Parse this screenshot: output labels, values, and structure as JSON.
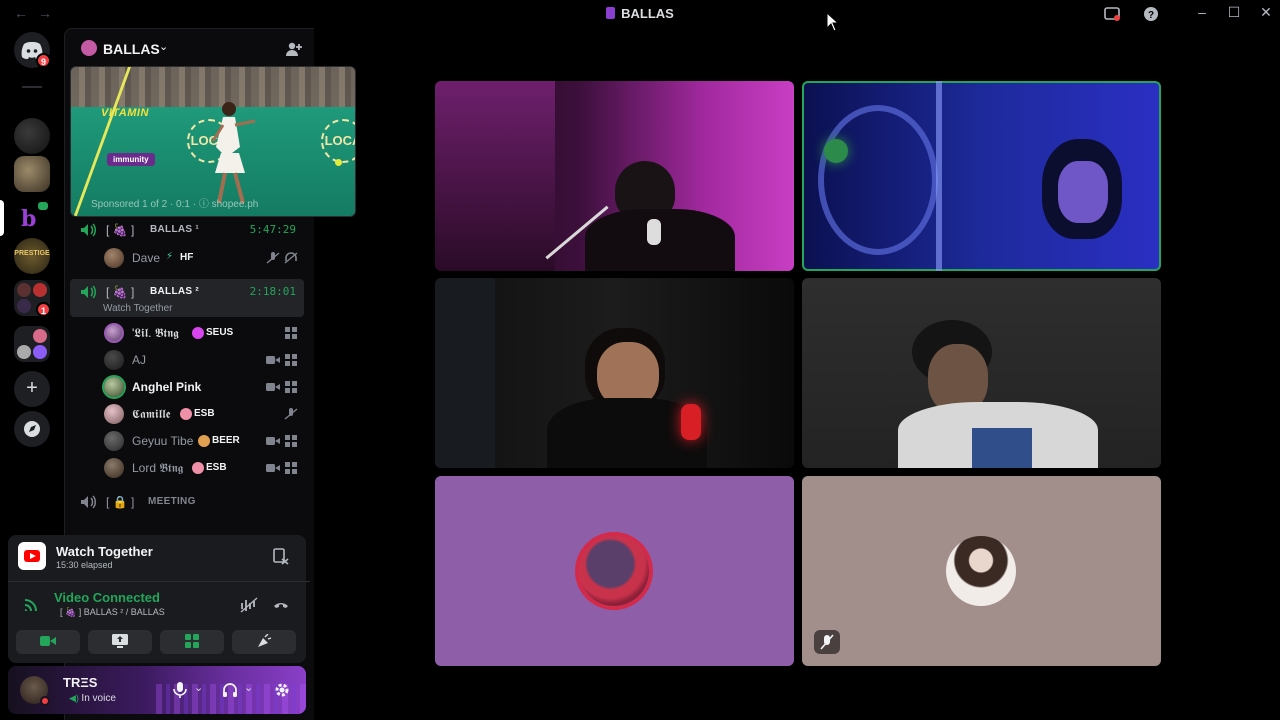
{
  "titlebar": {
    "title": "BALLAS"
  },
  "rail": {
    "dm_badge": "9",
    "folder_badge": "1"
  },
  "server": {
    "name": "BALLAS"
  },
  "ad": {
    "headline": "VITAMIN",
    "tag": "immunity",
    "brand": "LOCA",
    "sponsored": "Sponsored 1 of 2 · 0:1 · ⓘ shopee.ph"
  },
  "channels": {
    "ballas1": {
      "label": "[ 🍇 ]",
      "name": "BALLAS ¹",
      "time": "5:47:29"
    },
    "ballas2": {
      "label": "[ 🍇 ]",
      "name": "BALLAS ²",
      "time": "2:18:01",
      "activity": "Watch Together"
    },
    "meeting": {
      "label": "[ 🔒 ]",
      "name": "MEETING"
    }
  },
  "members_ballas1": [
    {
      "name": "Dave",
      "tag": "HF"
    }
  ],
  "members_ballas2": [
    {
      "name": "'𝕷𝖎𝖑. 𝕭𝖙𝖓𝖌",
      "tag": "SEUS"
    },
    {
      "name": "AJ"
    },
    {
      "name": "Anghel Pink"
    },
    {
      "name": "𝕮𝖆𝖒𝖎𝖑𝖑𝖊",
      "tag": "ESB"
    },
    {
      "name": "Geyuu Tibe",
      "tag": "BEER"
    },
    {
      "name": "Lord 𝕭𝖙𝖓𝖌",
      "tag": "ESB"
    }
  ],
  "activity_panel": {
    "title": "Watch Together",
    "elapsed": "15:30 elapsed",
    "voice_status": "Video Connected",
    "voice_channel": "[ 🍇 ] BALLAS ² / BALLAS"
  },
  "user": {
    "name": "TRΞS",
    "status": "In voice"
  },
  "colors": {
    "accent_green": "#23a55a",
    "brand_purple": "#8b3fd0",
    "tile_purple": "#8e5fa8",
    "tile_beige": "#a28f8c"
  }
}
